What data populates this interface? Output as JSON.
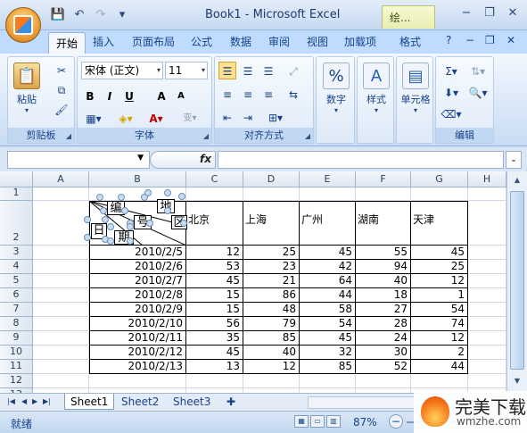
{
  "window": {
    "title": "Book1 - Microsoft Excel",
    "context_tab": "绘...",
    "controls": [
      "−",
      "❐",
      "✕"
    ]
  },
  "qat": {
    "save": "💾",
    "undo": "↶",
    "redo": "↷",
    "more": "▾"
  },
  "tabs": {
    "items": [
      "开始",
      "插入",
      "页面布局",
      "公式",
      "数据",
      "审阅",
      "视图",
      "加载项",
      "格式"
    ],
    "right": [
      "?",
      "−",
      "❐",
      "✕"
    ]
  },
  "ribbon": {
    "clipboard": {
      "label": "剪贴板",
      "paste": "粘贴",
      "paste_arrow": "▾"
    },
    "font": {
      "label": "字体",
      "name": "宋体 (正文)",
      "size": "11",
      "bold": "B",
      "italic": "I",
      "underline": "U",
      "grow": "A",
      "shrink": "A",
      "font_color": "A",
      "wen": "变"
    },
    "alignment": {
      "label": "对齐方式"
    },
    "number": {
      "label": "数字"
    },
    "styles": {
      "label": "样式"
    },
    "cells": {
      "label": "单元格"
    },
    "editing": {
      "label": "编辑",
      "sigma": "Σ"
    }
  },
  "formula_bar": {
    "fx": "fx",
    "name_box": "",
    "formula": ""
  },
  "sheet": {
    "columns": [
      "A",
      "B",
      "C",
      "D",
      "E",
      "F",
      "G",
      "H"
    ],
    "rows": [
      "1",
      "2",
      "3",
      "4",
      "5",
      "6",
      "7",
      "8",
      "9",
      "10",
      "11",
      "12",
      "13"
    ],
    "header_row": [
      "北京",
      "上海",
      "广州",
      "湖南",
      "天津"
    ],
    "data": [
      {
        "date": "2010/2/5",
        "values": [
          "12",
          "25",
          "45",
          "55",
          "45"
        ]
      },
      {
        "date": "2010/2/6",
        "values": [
          "53",
          "23",
          "42",
          "94",
          "25"
        ]
      },
      {
        "date": "2010/2/7",
        "values": [
          "45",
          "21",
          "64",
          "40",
          "12"
        ]
      },
      {
        "date": "2010/2/8",
        "values": [
          "15",
          "86",
          "44",
          "18",
          "1"
        ]
      },
      {
        "date": "2010/2/9",
        "values": [
          "15",
          "48",
          "58",
          "27",
          "54"
        ]
      },
      {
        "date": "2010/2/10",
        "values": [
          "56",
          "79",
          "54",
          "28",
          "74"
        ]
      },
      {
        "date": "2010/2/11",
        "values": [
          "35",
          "85",
          "45",
          "24",
          "12"
        ]
      },
      {
        "date": "2010/2/12",
        "values": [
          "45",
          "40",
          "32",
          "30",
          "2"
        ]
      },
      {
        "date": "2010/2/13",
        "values": [
          "13",
          "12",
          "85",
          "52",
          "44"
        ]
      }
    ],
    "diagonal_labels": {
      "bian": "编",
      "hao": "号",
      "di": "地",
      "qu": "区",
      "ri": "日",
      "qi": "期"
    }
  },
  "sheet_tabs": [
    "Sheet1",
    "Sheet2",
    "Sheet3"
  ],
  "status": {
    "ready": "就绪",
    "zoom": "87%",
    "zoom_minus": "−"
  },
  "watermark": {
    "brand": "完美下载",
    "url": "wmzhe.com"
  }
}
